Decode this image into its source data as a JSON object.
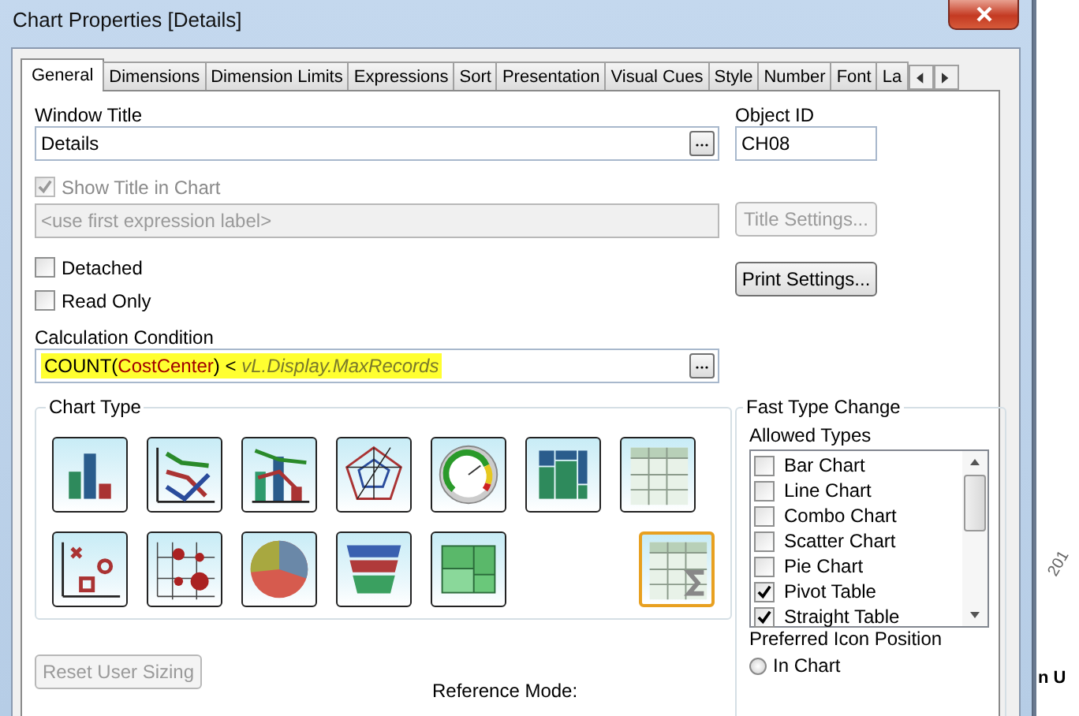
{
  "window": {
    "title": "Chart Properties [Details]"
  },
  "tabs": [
    {
      "label": "General",
      "selected": true
    },
    {
      "label": "Dimensions",
      "selected": false
    },
    {
      "label": "Dimension Limits",
      "selected": false
    },
    {
      "label": "Expressions",
      "selected": false
    },
    {
      "label": "Sort",
      "selected": false
    },
    {
      "label": "Presentation",
      "selected": false
    },
    {
      "label": "Visual Cues",
      "selected": false
    },
    {
      "label": "Style",
      "selected": false
    },
    {
      "label": "Number",
      "selected": false
    },
    {
      "label": "Font",
      "selected": false
    },
    {
      "label": "La",
      "selected": false
    }
  ],
  "window_title": {
    "label": "Window Title",
    "value": "Details"
  },
  "object_id": {
    "label": "Object ID",
    "value": "CH08"
  },
  "show_title": {
    "label": "Show Title in Chart",
    "checked": true,
    "disabled": true
  },
  "title_field": {
    "placeholder": "<use first expression label>",
    "disabled": true
  },
  "title_settings": {
    "label": "Title Settings...",
    "disabled": true
  },
  "detached": {
    "label": "Detached",
    "checked": false
  },
  "read_only": {
    "label": "Read Only",
    "checked": false
  },
  "print_settings": {
    "label": "Print Settings...",
    "disabled": false
  },
  "calculation_condition": {
    "label": "Calculation Condition",
    "highlighted": true,
    "tokens": [
      {
        "text": "COUNT",
        "kind": "function"
      },
      {
        "text": "(",
        "kind": "operator"
      },
      {
        "text": "CostCenter",
        "kind": "field"
      },
      {
        "text": ")",
        "kind": "operator"
      },
      {
        "text": " < ",
        "kind": "operator"
      },
      {
        "text": "vL.Display.MaxRecords",
        "kind": "variable"
      }
    ]
  },
  "chart_type": {
    "title": "Chart Type",
    "types": [
      {
        "kind": "bar",
        "selected": false
      },
      {
        "kind": "line",
        "selected": false
      },
      {
        "kind": "combo",
        "selected": false
      },
      {
        "kind": "radar",
        "selected": false
      },
      {
        "kind": "gauge",
        "selected": false
      },
      {
        "kind": "mekko",
        "selected": false
      },
      {
        "kind": "pivot",
        "selected": false
      },
      {
        "kind": "scatter",
        "selected": false
      },
      {
        "kind": "grid",
        "selected": false
      },
      {
        "kind": "pie",
        "selected": false
      },
      {
        "kind": "funnel",
        "selected": false
      },
      {
        "kind": "block",
        "selected": false
      },
      {
        "kind": "straight",
        "selected": true
      }
    ]
  },
  "reset_user_sizing": {
    "label": "Reset User Sizing",
    "disabled": true
  },
  "reference_mode": {
    "label": "Reference Mode:"
  },
  "fast_type_change": {
    "title": "Fast Type Change",
    "allowed_types_label": "Allowed Types",
    "allowed_types": [
      {
        "label": "Bar Chart",
        "checked": false
      },
      {
        "label": "Line Chart",
        "checked": false
      },
      {
        "label": "Combo Chart",
        "checked": false
      },
      {
        "label": "Scatter Chart",
        "checked": false
      },
      {
        "label": "Pie Chart",
        "checked": false
      },
      {
        "label": "Pivot Table",
        "checked": true
      },
      {
        "label": "Straight Table",
        "checked": true
      }
    ],
    "preferred_icon_position": {
      "label": "Preferred Icon Position",
      "options": [
        {
          "label": "In Chart",
          "selected": false
        }
      ]
    }
  },
  "background_window": {
    "axis_label": "201",
    "header": "n U"
  }
}
